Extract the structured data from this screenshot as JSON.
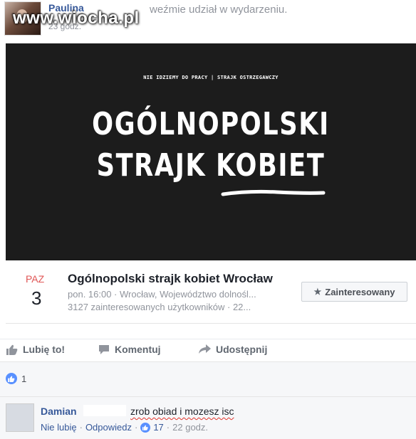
{
  "post": {
    "author": "Paulina",
    "time": "23 godz.",
    "action_text": "weźmie udział w wydarzeniu.",
    "watermark": "www.wiocha.pl"
  },
  "banner": {
    "small_text": "NIE IDZIEMY DO PRACY | STRAJK OSTRZEGAWCZY",
    "line1": "OGÓLNOPOLSKI",
    "line2": "STRAJK KOBIET"
  },
  "event": {
    "day_name": "PAZ",
    "day_number": "3",
    "title": "Ogólnopolski strajk kobiet Wrocław",
    "details": "pon. 16:00 · Wrocław, Województwo dolnośl...",
    "interested_count": "3127 zainteresowanych użytkowników · 22...",
    "interested_button": "Zainteresowany",
    "interested_icon": "star-icon"
  },
  "actions": {
    "like": "Lubię to!",
    "comment": "Komentuj",
    "share": "Udostępnij"
  },
  "reactions": {
    "like_count": "1"
  },
  "comment": {
    "author": "Damian",
    "text": "zrob obiad i mozesz isc",
    "unlike": "Nie lubię",
    "reply": "Odpowiedz",
    "likes": "17",
    "time": "22 godz."
  },
  "colors": {
    "link": "#365899",
    "like_blue": "#5890ff",
    "event_day": "#e05555",
    "banner_bg": "#1c1c1c"
  }
}
